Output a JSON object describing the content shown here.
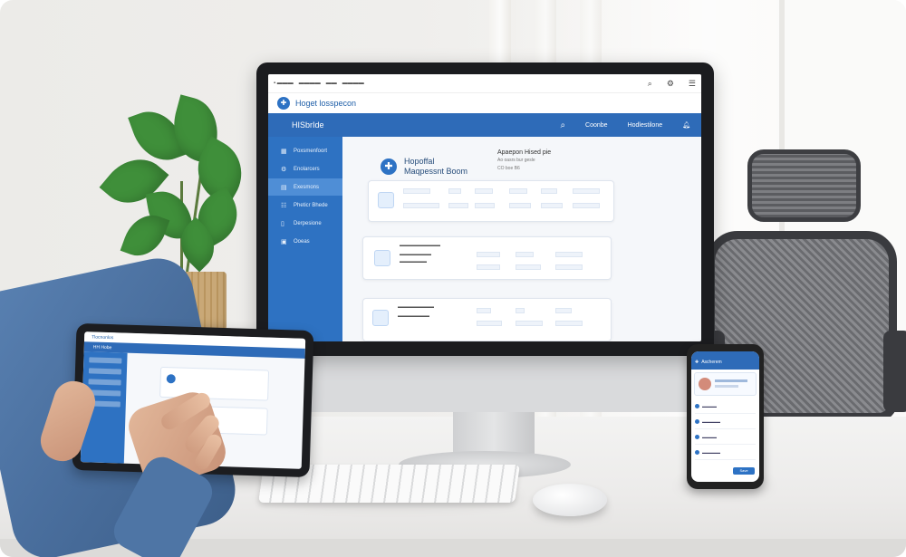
{
  "desktop_app": {
    "brand": "Hoget losspecon",
    "nav_title": "HISbrIde",
    "nav_links": [
      "Coonbe",
      "Hodlestilone"
    ],
    "sidebar_items": [
      {
        "label": "Poxsmenfoort",
        "icon": "calendar-icon",
        "active": false
      },
      {
        "label": "Enolarcers",
        "icon": "gear-icon",
        "active": false
      },
      {
        "label": "Exesmons",
        "icon": "chart-icon",
        "active": true
      },
      {
        "label": "Pheticr Bhede",
        "icon": "list-icon",
        "active": false
      },
      {
        "label": "Derpesione",
        "icon": "file-icon",
        "active": false
      },
      {
        "label": "Ooeas",
        "icon": "grid-icon",
        "active": false
      }
    ],
    "header_title_line1": "Hopoffal",
    "header_title_line2": "Maqpessnt Boom",
    "header_right_title": "Apaepon Hised pie",
    "header_right_sub": "Ao oasrs bur gesle",
    "header_right_sub2": "CO boe B6"
  },
  "tablet_app": {
    "brand": "Tlocnonlos",
    "nav_title": "HH Hobe"
  },
  "phone_app": {
    "title": "Ascherem",
    "button": "Save"
  },
  "colors": {
    "brand_blue": "#2e6bb8",
    "sidebar_blue": "#2e72c2",
    "active_blue": "#4f8ed6"
  }
}
